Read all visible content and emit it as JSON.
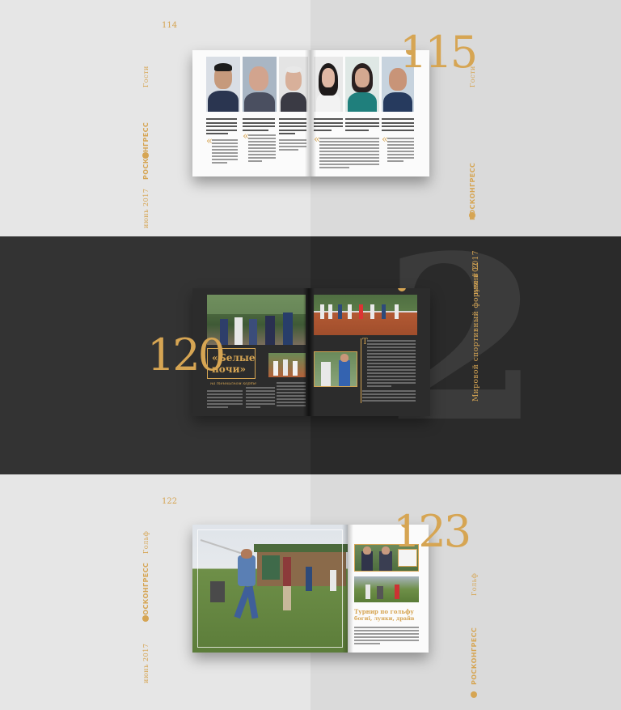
{
  "brand": "РОСКОНГРЕСС",
  "colors": {
    "accent": "#d6a553",
    "dark_band": "#333333",
    "light_band": "#e6e6e6"
  },
  "band1": {
    "page_left": "114",
    "page_right": "115",
    "side_label": "Гости",
    "date_text": "июнь 2017",
    "icon": "roscongress-logo-icon"
  },
  "band2": {
    "page_left": "120",
    "page_right": "2",
    "title_line1": "«Белые",
    "title_line2": "ночи»",
    "subtitle": "на теннисном корте",
    "spine_text": "Мировой спортивный форум #02",
    "spine_date": "июнь 2017"
  },
  "band3": {
    "page_left": "122",
    "page_right": "123",
    "side_label": "Гольф",
    "date_text": "июнь 2017",
    "title_line1": "Турнир по гольфу",
    "title_line2": "богиі, лунки, драйв",
    "icon": "roscongress-logo-icon"
  }
}
